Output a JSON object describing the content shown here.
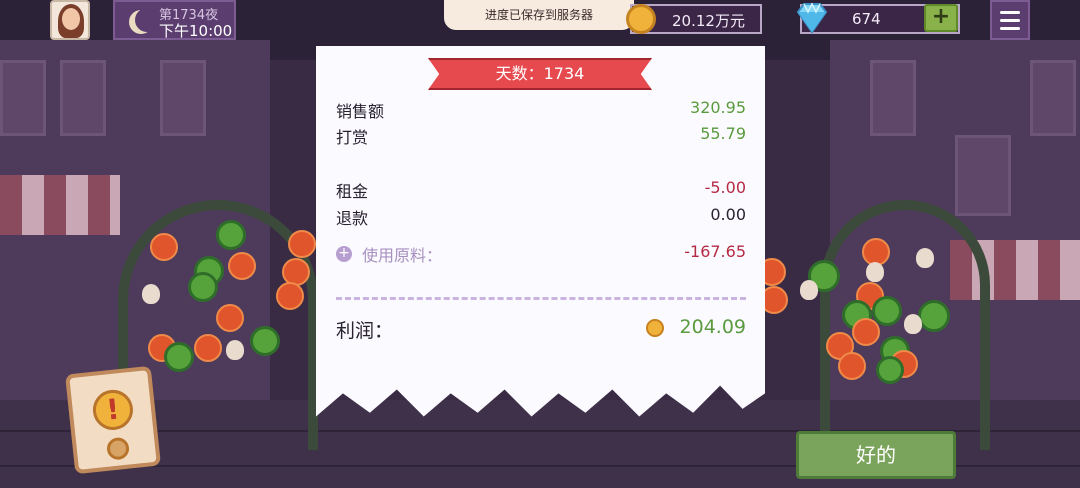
{
  "hud": {
    "night_label": "第1734夜",
    "time_label": "下午10:00",
    "toast": "进度已保存到服务器",
    "coins": "20.12万元",
    "gems": "674",
    "add_label": "+"
  },
  "receipt": {
    "ribbon": "天数：1734",
    "rows": [
      {
        "label": "销售额",
        "value": "320.95"
      },
      {
        "label": "打赏",
        "value": "55.79"
      },
      {
        "label": "租金",
        "value": "-5.00"
      },
      {
        "label": "退款",
        "value": "0.00"
      },
      {
        "label": "使用原料：",
        "value": "-167.65"
      }
    ],
    "profit_label": "利润：",
    "profit_value": "204.09"
  },
  "buttons": {
    "ok_label": "好的",
    "alert_symbol": "!"
  },
  "icons": {
    "moon": "moon-icon",
    "coin": "coin-icon",
    "gem": "diamond-icon",
    "menu": "hamburger-menu-icon"
  },
  "colors": {
    "positive": "#5a9b3f",
    "negative": "#b52b45",
    "ribbon": "#e64a4f",
    "ok_button": "#7aa35b"
  }
}
